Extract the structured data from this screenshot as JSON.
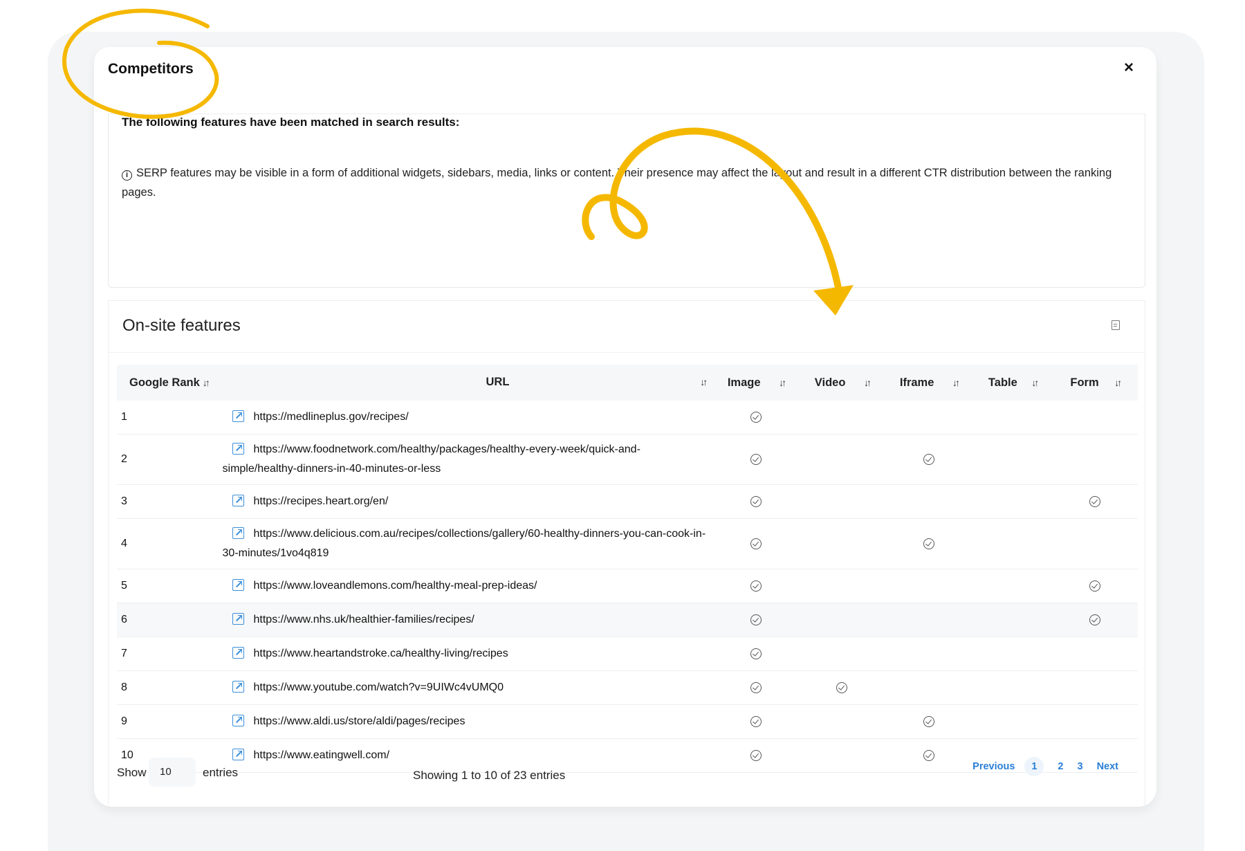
{
  "modal": {
    "title": "Competitors",
    "close_label": "×"
  },
  "serp": {
    "heading": "The following features have been matched in search results:",
    "info_glyph": "i",
    "note": "SERP features may be visible in a form of additional widgets, sidebars, media, links or content. Their presence may affect the layout and result in a different CTR distribution between the ranking pages."
  },
  "onsite": {
    "title": "On-site features",
    "columns": {
      "rank": "Google Rank",
      "url": "URL",
      "image": "Image",
      "video": "Video",
      "iframe": "Iframe",
      "table": "Table",
      "form": "Form"
    },
    "sort_glyph": "↓↑",
    "check_mark": "✓",
    "rows": [
      {
        "rank": "1",
        "url": "https://medlineplus.gov/recipes/",
        "image": true,
        "video": false,
        "iframe": false,
        "table": false,
        "form": false
      },
      {
        "rank": "2",
        "url": "https://www.foodnetwork.com/healthy/packages/healthy-every-week/quick-and-simple/healthy-dinners-in-40-minutes-or-less",
        "image": true,
        "video": false,
        "iframe": true,
        "table": false,
        "form": false
      },
      {
        "rank": "3",
        "url": "https://recipes.heart.org/en/",
        "image": true,
        "video": false,
        "iframe": false,
        "table": false,
        "form": true
      },
      {
        "rank": "4",
        "url": "https://www.delicious.com.au/recipes/collections/gallery/60-healthy-dinners-you-can-cook-in-30-minutes/1vo4q819",
        "image": true,
        "video": false,
        "iframe": true,
        "table": false,
        "form": false
      },
      {
        "rank": "5",
        "url": "https://www.loveandlemons.com/healthy-meal-prep-ideas/",
        "image": true,
        "video": false,
        "iframe": false,
        "table": false,
        "form": true
      },
      {
        "rank": "6",
        "url": "https://www.nhs.uk/healthier-families/recipes/",
        "image": true,
        "video": false,
        "iframe": false,
        "table": false,
        "form": true
      },
      {
        "rank": "7",
        "url": "https://www.heartandstroke.ca/healthy-living/recipes",
        "image": true,
        "video": false,
        "iframe": false,
        "table": false,
        "form": false
      },
      {
        "rank": "8",
        "url": "https://www.youtube.com/watch?v=9UIWc4vUMQ0",
        "image": true,
        "video": true,
        "iframe": false,
        "table": false,
        "form": false
      },
      {
        "rank": "9",
        "url": "https://www.aldi.us/store/aldi/pages/recipes",
        "image": true,
        "video": false,
        "iframe": true,
        "table": false,
        "form": false
      },
      {
        "rank": "10",
        "url": "https://www.eatingwell.com/",
        "image": true,
        "video": false,
        "iframe": true,
        "table": false,
        "form": false
      }
    ],
    "highlighted_row": "6"
  },
  "footer": {
    "show_label": "Show",
    "page_size": "10",
    "entries_label": "entries",
    "info": "Showing 1 to 10 of 23 entries",
    "pager": {
      "previous": "Previous",
      "pages": [
        "1",
        "2",
        "3"
      ],
      "active_page": "1",
      "next": "Next"
    }
  },
  "colors": {
    "annotation_yellow": "#f5b800",
    "link_blue": "#2a7fd6"
  }
}
